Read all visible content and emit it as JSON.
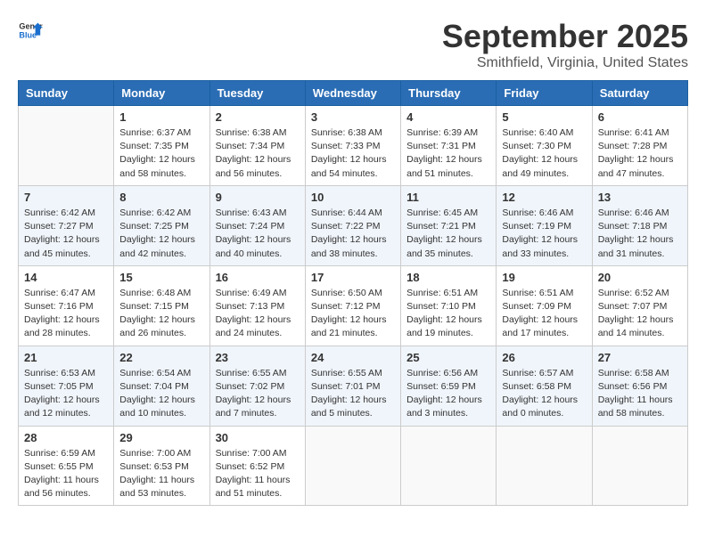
{
  "header": {
    "logo_general": "General",
    "logo_blue": "Blue",
    "month": "September 2025",
    "location": "Smithfield, Virginia, United States"
  },
  "days_of_week": [
    "Sunday",
    "Monday",
    "Tuesday",
    "Wednesday",
    "Thursday",
    "Friday",
    "Saturday"
  ],
  "weeks": [
    [
      {
        "num": "",
        "info": ""
      },
      {
        "num": "1",
        "info": "Sunrise: 6:37 AM\nSunset: 7:35 PM\nDaylight: 12 hours\nand 58 minutes."
      },
      {
        "num": "2",
        "info": "Sunrise: 6:38 AM\nSunset: 7:34 PM\nDaylight: 12 hours\nand 56 minutes."
      },
      {
        "num": "3",
        "info": "Sunrise: 6:38 AM\nSunset: 7:33 PM\nDaylight: 12 hours\nand 54 minutes."
      },
      {
        "num": "4",
        "info": "Sunrise: 6:39 AM\nSunset: 7:31 PM\nDaylight: 12 hours\nand 51 minutes."
      },
      {
        "num": "5",
        "info": "Sunrise: 6:40 AM\nSunset: 7:30 PM\nDaylight: 12 hours\nand 49 minutes."
      },
      {
        "num": "6",
        "info": "Sunrise: 6:41 AM\nSunset: 7:28 PM\nDaylight: 12 hours\nand 47 minutes."
      }
    ],
    [
      {
        "num": "7",
        "info": "Sunrise: 6:42 AM\nSunset: 7:27 PM\nDaylight: 12 hours\nand 45 minutes."
      },
      {
        "num": "8",
        "info": "Sunrise: 6:42 AM\nSunset: 7:25 PM\nDaylight: 12 hours\nand 42 minutes."
      },
      {
        "num": "9",
        "info": "Sunrise: 6:43 AM\nSunset: 7:24 PM\nDaylight: 12 hours\nand 40 minutes."
      },
      {
        "num": "10",
        "info": "Sunrise: 6:44 AM\nSunset: 7:22 PM\nDaylight: 12 hours\nand 38 minutes."
      },
      {
        "num": "11",
        "info": "Sunrise: 6:45 AM\nSunset: 7:21 PM\nDaylight: 12 hours\nand 35 minutes."
      },
      {
        "num": "12",
        "info": "Sunrise: 6:46 AM\nSunset: 7:19 PM\nDaylight: 12 hours\nand 33 minutes."
      },
      {
        "num": "13",
        "info": "Sunrise: 6:46 AM\nSunset: 7:18 PM\nDaylight: 12 hours\nand 31 minutes."
      }
    ],
    [
      {
        "num": "14",
        "info": "Sunrise: 6:47 AM\nSunset: 7:16 PM\nDaylight: 12 hours\nand 28 minutes."
      },
      {
        "num": "15",
        "info": "Sunrise: 6:48 AM\nSunset: 7:15 PM\nDaylight: 12 hours\nand 26 minutes."
      },
      {
        "num": "16",
        "info": "Sunrise: 6:49 AM\nSunset: 7:13 PM\nDaylight: 12 hours\nand 24 minutes."
      },
      {
        "num": "17",
        "info": "Sunrise: 6:50 AM\nSunset: 7:12 PM\nDaylight: 12 hours\nand 21 minutes."
      },
      {
        "num": "18",
        "info": "Sunrise: 6:51 AM\nSunset: 7:10 PM\nDaylight: 12 hours\nand 19 minutes."
      },
      {
        "num": "19",
        "info": "Sunrise: 6:51 AM\nSunset: 7:09 PM\nDaylight: 12 hours\nand 17 minutes."
      },
      {
        "num": "20",
        "info": "Sunrise: 6:52 AM\nSunset: 7:07 PM\nDaylight: 12 hours\nand 14 minutes."
      }
    ],
    [
      {
        "num": "21",
        "info": "Sunrise: 6:53 AM\nSunset: 7:05 PM\nDaylight: 12 hours\nand 12 minutes."
      },
      {
        "num": "22",
        "info": "Sunrise: 6:54 AM\nSunset: 7:04 PM\nDaylight: 12 hours\nand 10 minutes."
      },
      {
        "num": "23",
        "info": "Sunrise: 6:55 AM\nSunset: 7:02 PM\nDaylight: 12 hours\nand 7 minutes."
      },
      {
        "num": "24",
        "info": "Sunrise: 6:55 AM\nSunset: 7:01 PM\nDaylight: 12 hours\nand 5 minutes."
      },
      {
        "num": "25",
        "info": "Sunrise: 6:56 AM\nSunset: 6:59 PM\nDaylight: 12 hours\nand 3 minutes."
      },
      {
        "num": "26",
        "info": "Sunrise: 6:57 AM\nSunset: 6:58 PM\nDaylight: 12 hours\nand 0 minutes."
      },
      {
        "num": "27",
        "info": "Sunrise: 6:58 AM\nSunset: 6:56 PM\nDaylight: 11 hours\nand 58 minutes."
      }
    ],
    [
      {
        "num": "28",
        "info": "Sunrise: 6:59 AM\nSunset: 6:55 PM\nDaylight: 11 hours\nand 56 minutes."
      },
      {
        "num": "29",
        "info": "Sunrise: 7:00 AM\nSunset: 6:53 PM\nDaylight: 11 hours\nand 53 minutes."
      },
      {
        "num": "30",
        "info": "Sunrise: 7:00 AM\nSunset: 6:52 PM\nDaylight: 11 hours\nand 51 minutes."
      },
      {
        "num": "",
        "info": ""
      },
      {
        "num": "",
        "info": ""
      },
      {
        "num": "",
        "info": ""
      },
      {
        "num": "",
        "info": ""
      }
    ]
  ]
}
